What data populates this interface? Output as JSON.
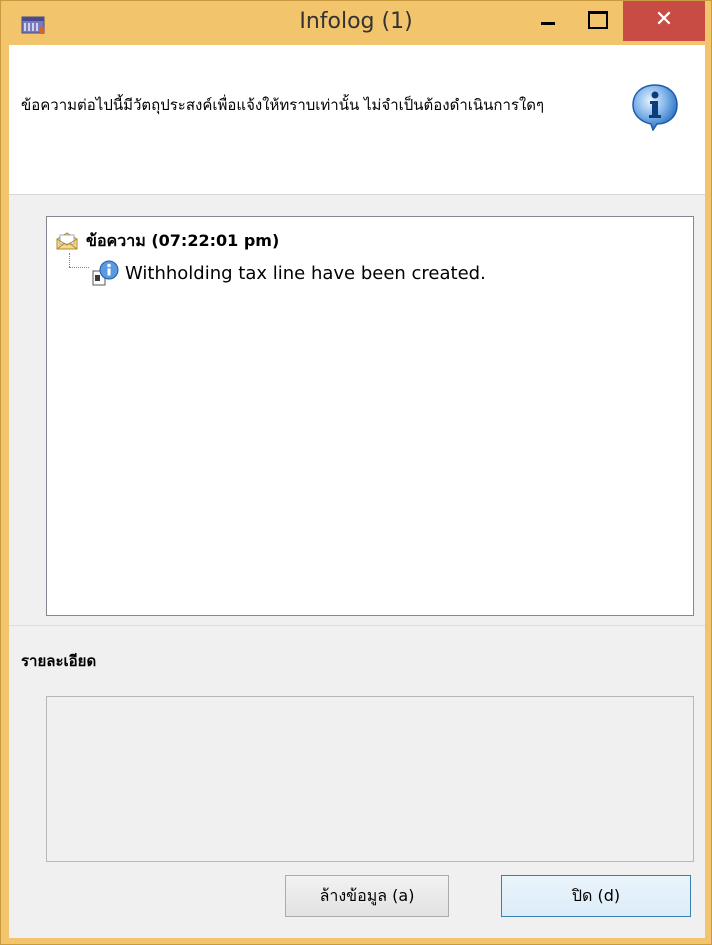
{
  "window": {
    "title": "Infolog (1)",
    "minimize_label": "",
    "maximize_label": "",
    "close_label": "✕"
  },
  "header": {
    "message": "ข้อความต่อไปนี้มีวัตถุประสงค์เพื่อแจ้งให้ทราบเท่านั้น ไม่จำเป็นต้องดำเนินการใดๆ"
  },
  "log": {
    "root": {
      "label": "ข้อความ (07:22:01 pm)",
      "icon": "envelope-icon"
    },
    "items": [
      {
        "text": "Withholding tax line have been created.",
        "icon": "document-info-icon"
      }
    ]
  },
  "details": {
    "label": "รายละเอียด",
    "content": ""
  },
  "buttons": {
    "clear_label": "ล้างข้อมูล (a)",
    "close_label": "ปิด (d)"
  },
  "colors": {
    "titlebar": "#f2c56c",
    "close_button": "#c94c44",
    "info_icon": "#2b6fc2"
  }
}
